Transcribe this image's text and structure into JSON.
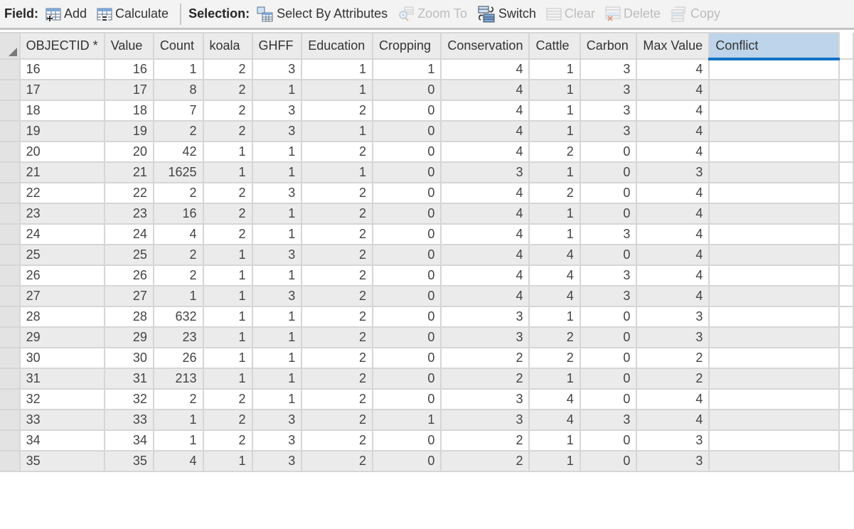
{
  "toolbar": {
    "field_label": "Field:",
    "add_label": "Add",
    "calculate_label": "Calculate",
    "selection_label": "Selection:",
    "select_by_attributes_label": "Select By Attributes",
    "zoom_to_label": "Zoom To",
    "switch_label": "Switch",
    "clear_label": "Clear",
    "delete_label": "Delete",
    "copy_label": "Copy"
  },
  "table": {
    "columns": [
      "OBJECTID *",
      "Value",
      "Count",
      "koala",
      "GHFF",
      "Education",
      "Cropping",
      "Conservation",
      "Cattle",
      "Carbon",
      "Max Value",
      "Conflict"
    ],
    "selected_column": "Conflict",
    "rows": [
      [
        "16",
        "16",
        "1",
        "2",
        "3",
        "1",
        "1",
        "4",
        "1",
        "3",
        "4",
        ""
      ],
      [
        "17",
        "17",
        "8",
        "2",
        "1",
        "1",
        "0",
        "4",
        "1",
        "3",
        "4",
        ""
      ],
      [
        "18",
        "18",
        "7",
        "2",
        "3",
        "2",
        "0",
        "4",
        "1",
        "3",
        "4",
        ""
      ],
      [
        "19",
        "19",
        "2",
        "2",
        "3",
        "1",
        "0",
        "4",
        "1",
        "3",
        "4",
        ""
      ],
      [
        "20",
        "20",
        "42",
        "1",
        "1",
        "2",
        "0",
        "4",
        "2",
        "0",
        "4",
        ""
      ],
      [
        "21",
        "21",
        "1625",
        "1",
        "1",
        "1",
        "0",
        "3",
        "1",
        "0",
        "3",
        ""
      ],
      [
        "22",
        "22",
        "2",
        "2",
        "3",
        "2",
        "0",
        "4",
        "2",
        "0",
        "4",
        ""
      ],
      [
        "23",
        "23",
        "16",
        "2",
        "1",
        "2",
        "0",
        "4",
        "1",
        "0",
        "4",
        ""
      ],
      [
        "24",
        "24",
        "4",
        "2",
        "1",
        "2",
        "0",
        "4",
        "1",
        "3",
        "4",
        ""
      ],
      [
        "25",
        "25",
        "2",
        "1",
        "3",
        "2",
        "0",
        "4",
        "4",
        "0",
        "4",
        ""
      ],
      [
        "26",
        "26",
        "2",
        "1",
        "1",
        "2",
        "0",
        "4",
        "4",
        "3",
        "4",
        ""
      ],
      [
        "27",
        "27",
        "1",
        "1",
        "3",
        "2",
        "0",
        "4",
        "4",
        "3",
        "4",
        ""
      ],
      [
        "28",
        "28",
        "632",
        "1",
        "1",
        "2",
        "0",
        "3",
        "1",
        "0",
        "3",
        ""
      ],
      [
        "29",
        "29",
        "23",
        "1",
        "1",
        "2",
        "0",
        "3",
        "2",
        "0",
        "3",
        ""
      ],
      [
        "30",
        "30",
        "26",
        "1",
        "1",
        "2",
        "0",
        "2",
        "2",
        "0",
        "2",
        ""
      ],
      [
        "31",
        "31",
        "213",
        "1",
        "1",
        "2",
        "0",
        "2",
        "1",
        "0",
        "2",
        ""
      ],
      [
        "32",
        "32",
        "2",
        "2",
        "1",
        "2",
        "0",
        "3",
        "4",
        "0",
        "4",
        ""
      ],
      [
        "33",
        "33",
        "1",
        "2",
        "3",
        "2",
        "1",
        "3",
        "4",
        "3",
        "4",
        ""
      ],
      [
        "34",
        "34",
        "1",
        "2",
        "3",
        "2",
        "0",
        "2",
        "1",
        "0",
        "3",
        ""
      ],
      [
        "35",
        "35",
        "4",
        "1",
        "3",
        "2",
        "0",
        "2",
        "1",
        "0",
        "3",
        ""
      ]
    ]
  }
}
